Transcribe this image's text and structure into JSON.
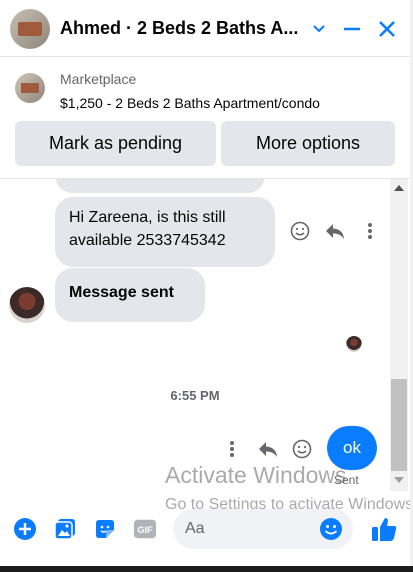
{
  "header": {
    "title": "Ahmed · 2 Beds 2 Baths A...",
    "buttons": [
      {
        "name": "chevron-down-icon"
      },
      {
        "name": "minimize-icon"
      },
      {
        "name": "close-icon"
      }
    ]
  },
  "listing": {
    "label": "Marketplace",
    "description": "$1,250 - 2 Beds 2 Baths Apartment/condo",
    "mark_pending_label": "Mark as pending",
    "more_options_label": "More options"
  },
  "messages": {
    "msg1": "Hi Zareena, is this still available 2533745342",
    "msg2": "Message sent",
    "timestamp": "6:55 PM",
    "outgoing": "ok",
    "status": "Sent"
  },
  "composer": {
    "placeholder": "Aa",
    "icons": [
      "plus-icon",
      "photo-icon",
      "sticker-icon",
      "gif-icon",
      "emoji-icon",
      "thumbs-up-icon"
    ]
  },
  "watermark": {
    "line1": "Activate Windows",
    "line2": "Go to Settings to activate Windows."
  },
  "colors": {
    "accent": "#0a7cff",
    "bubble_gray": "#e4e6eb",
    "text_secondary": "#65676b"
  }
}
